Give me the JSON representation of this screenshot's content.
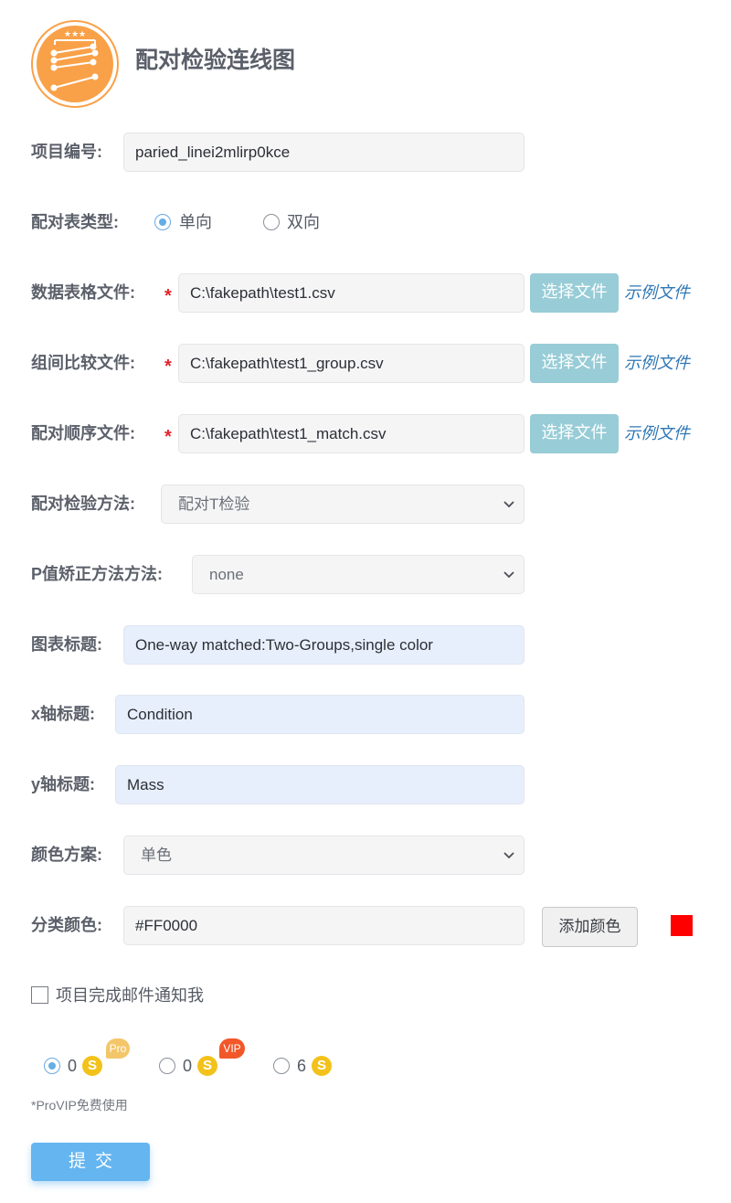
{
  "app": {
    "title": "配对检验连线图",
    "logo_icon": "paired-lines-logo-icon",
    "logo_stars": "★★★"
  },
  "form": {
    "project_id": {
      "label": "项目编号:",
      "value": "paried_linei2mlirp0kce"
    },
    "table_type": {
      "label": "配对表类型:",
      "options": [
        {
          "label": "单向",
          "checked": true
        },
        {
          "label": "双向",
          "checked": false
        }
      ]
    },
    "data_file": {
      "label": "数据表格文件:",
      "required_mark": "*",
      "value": "C:\\fakepath\\test1.csv",
      "button": "选择文件",
      "example": "示例文件"
    },
    "group_file": {
      "label": "组间比较文件:",
      "required_mark": "*",
      "value": "C:\\fakepath\\test1_group.csv",
      "button": "选择文件",
      "example": "示例文件"
    },
    "match_file": {
      "label": "配对顺序文件:",
      "required_mark": "*",
      "value": "C:\\fakepath\\test1_match.csv",
      "button": "选择文件",
      "example": "示例文件"
    },
    "test_method": {
      "label": "配对检验方法:",
      "selected": "配对T检验"
    },
    "p_adjust": {
      "label": "P值矫正方法方法:",
      "selected": "none"
    },
    "chart_title": {
      "label": "图表标题:",
      "value": "One-way matched:Two-Groups,single color"
    },
    "x_title": {
      "label": "x轴标题:",
      "value": "Condition"
    },
    "y_title": {
      "label": "y轴标题:",
      "value": "Mass"
    },
    "color_scheme": {
      "label": "颜色方案:",
      "selected": "单色"
    },
    "class_color": {
      "label": "分类颜色:",
      "value": "#FF0000",
      "button": "添加颜色",
      "swatch_color": "#ff0000"
    },
    "email_notify": {
      "label": "项目完成邮件通知我",
      "checked": false
    }
  },
  "pricing": {
    "options": [
      {
        "amount": "0",
        "badge": "Pro",
        "badge_color": "#f3c66a",
        "checked": true
      },
      {
        "amount": "0",
        "badge": "VIP",
        "badge_color": "#f2572a",
        "checked": false
      },
      {
        "amount": "6",
        "badge": "",
        "checked": false
      }
    ],
    "coin_symbol": "S",
    "note": "*ProVIP免费使用"
  },
  "submit": {
    "label": "提交"
  },
  "colors": {
    "file_button": "#98ccd6",
    "link": "#2f77b5",
    "submit": "#65b5f0",
    "input_highlight": "#e8effc",
    "logo_orange": "#f9a148"
  }
}
